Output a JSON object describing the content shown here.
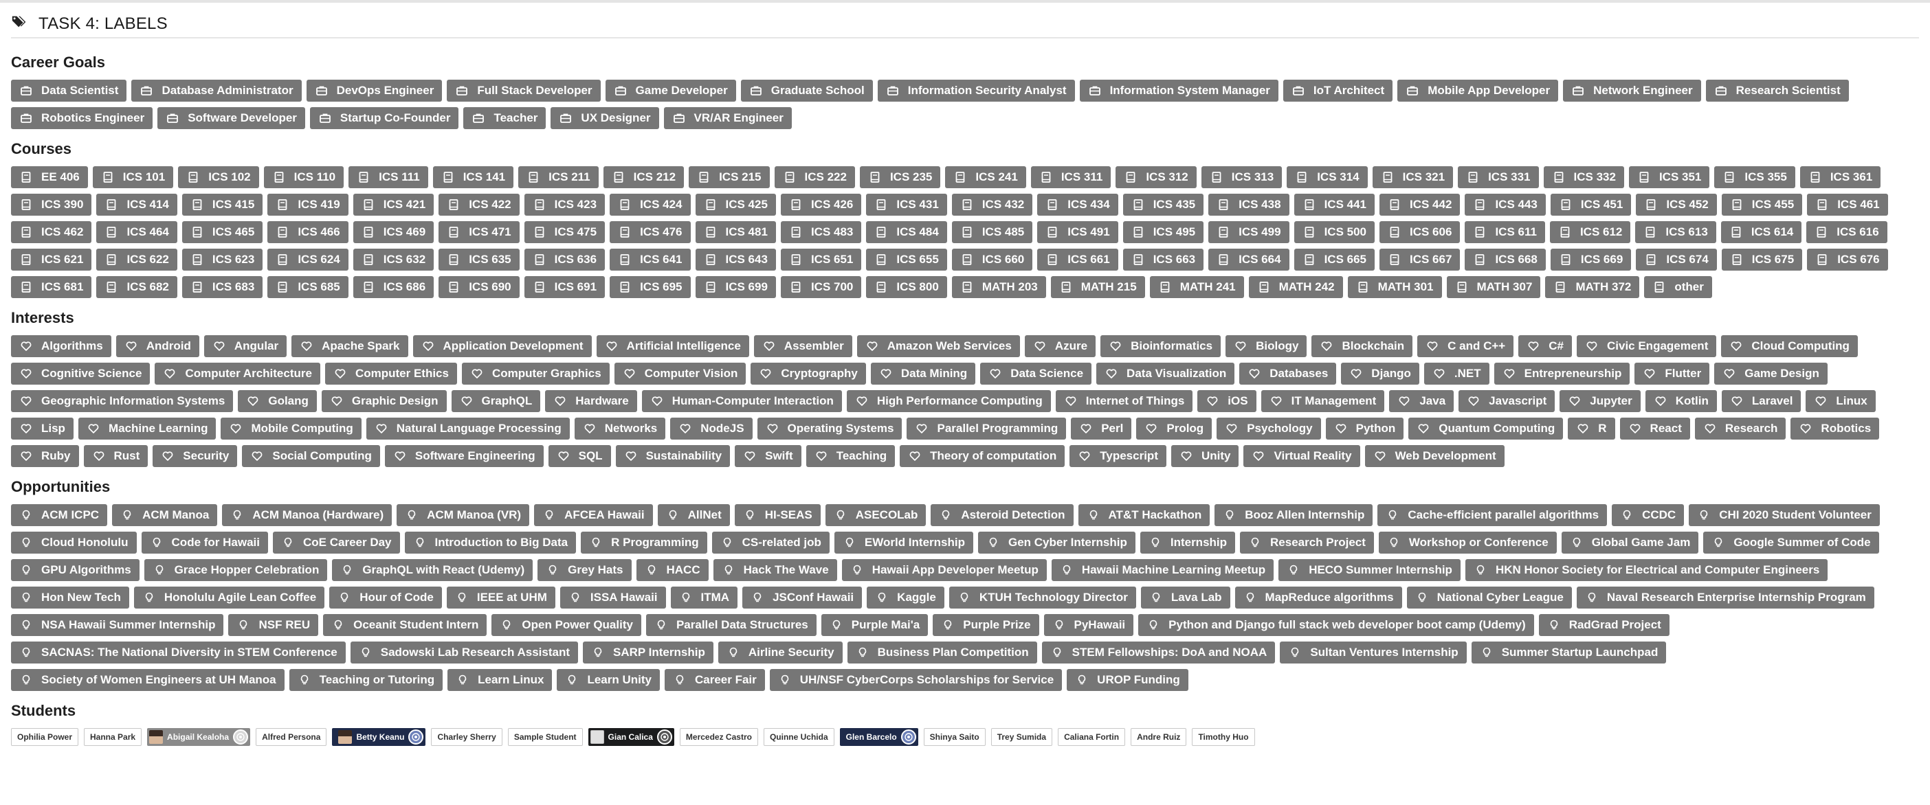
{
  "task_title": "TASK 4: LABELS",
  "sections": {
    "career_goals": {
      "title": "Career Goals",
      "icon": "briefcase-icon",
      "items": [
        "Data Scientist",
        "Database Administrator",
        "DevOps Engineer",
        "Full Stack Developer",
        "Game Developer",
        "Graduate School",
        "Information Security Analyst",
        "Information System Manager",
        "IoT Architect",
        "Mobile App Developer",
        "Network Engineer",
        "Research Scientist",
        "Robotics Engineer",
        "Software Developer",
        "Startup Co-Founder",
        "Teacher",
        "UX Designer",
        "VR/AR Engineer"
      ]
    },
    "courses": {
      "title": "Courses",
      "icon": "book-icon",
      "items": [
        "EE 406",
        "ICS 101",
        "ICS 102",
        "ICS 110",
        "ICS 111",
        "ICS 141",
        "ICS 211",
        "ICS 212",
        "ICS 215",
        "ICS 222",
        "ICS 235",
        "ICS 241",
        "ICS 311",
        "ICS 312",
        "ICS 313",
        "ICS 314",
        "ICS 321",
        "ICS 331",
        "ICS 332",
        "ICS 351",
        "ICS 355",
        "ICS 361",
        "ICS 390",
        "ICS 414",
        "ICS 415",
        "ICS 419",
        "ICS 421",
        "ICS 422",
        "ICS 423",
        "ICS 424",
        "ICS 425",
        "ICS 426",
        "ICS 431",
        "ICS 432",
        "ICS 434",
        "ICS 435",
        "ICS 438",
        "ICS 441",
        "ICS 442",
        "ICS 443",
        "ICS 451",
        "ICS 452",
        "ICS 455",
        "ICS 461",
        "ICS 462",
        "ICS 464",
        "ICS 465",
        "ICS 466",
        "ICS 469",
        "ICS 471",
        "ICS 475",
        "ICS 476",
        "ICS 481",
        "ICS 483",
        "ICS 484",
        "ICS 485",
        "ICS 491",
        "ICS 495",
        "ICS 499",
        "ICS 500",
        "ICS 606",
        "ICS 611",
        "ICS 612",
        "ICS 613",
        "ICS 614",
        "ICS 616",
        "ICS 621",
        "ICS 622",
        "ICS 623",
        "ICS 624",
        "ICS 632",
        "ICS 635",
        "ICS 636",
        "ICS 641",
        "ICS 643",
        "ICS 651",
        "ICS 655",
        "ICS 660",
        "ICS 661",
        "ICS 663",
        "ICS 664",
        "ICS 665",
        "ICS 667",
        "ICS 668",
        "ICS 669",
        "ICS 674",
        "ICS 675",
        "ICS 676",
        "ICS 681",
        "ICS 682",
        "ICS 683",
        "ICS 685",
        "ICS 686",
        "ICS 690",
        "ICS 691",
        "ICS 695",
        "ICS 699",
        "ICS 700",
        "ICS 800",
        "MATH 203",
        "MATH 215",
        "MATH 241",
        "MATH 242",
        "MATH 301",
        "MATH 307",
        "MATH 372",
        "other"
      ]
    },
    "interests": {
      "title": "Interests",
      "icon": "heart-outline-icon",
      "items": [
        "Algorithms",
        "Android",
        "Angular",
        "Apache Spark",
        "Application Development",
        "Artificial Intelligence",
        "Assembler",
        "Amazon Web Services",
        "Azure",
        "Bioinformatics",
        "Biology",
        "Blockchain",
        "C and C++",
        "C#",
        "Civic Engagement",
        "Cloud Computing",
        "Cognitive Science",
        "Computer Architecture",
        "Computer Ethics",
        "Computer Graphics",
        "Computer Vision",
        "Cryptography",
        "Data Mining",
        "Data Science",
        "Data Visualization",
        "Databases",
        "Django",
        ".NET",
        "Entrepreneurship",
        "Flutter",
        "Game Design",
        "Geographic Information Systems",
        "Golang",
        "Graphic Design",
        "GraphQL",
        "Hardware",
        "Human-Computer Interaction",
        "High Performance Computing",
        "Internet of Things",
        "iOS",
        "IT Management",
        "Java",
        "Javascript",
        "Jupyter",
        "Kotlin",
        "Laravel",
        "Linux",
        "Lisp",
        "Machine Learning",
        "Mobile Computing",
        "Natural Language Processing",
        "Networks",
        "NodeJS",
        "Operating Systems",
        "Parallel Programming",
        "Perl",
        "Prolog",
        "Psychology",
        "Python",
        "Quantum Computing",
        "R",
        "React",
        "Research",
        "Robotics",
        "Ruby",
        "Rust",
        "Security",
        "Social Computing",
        "Software Engineering",
        "SQL",
        "Sustainability",
        "Swift",
        "Teaching",
        "Theory of computation",
        "Typescript",
        "Unity",
        "Virtual Reality",
        "Web Development"
      ]
    },
    "opportunities": {
      "title": "Opportunities",
      "icon": "lightbulb-icon",
      "items": [
        "ACM ICPC",
        "ACM Manoa",
        "ACM Manoa (Hardware)",
        "ACM Manoa (VR)",
        "AFCEA Hawaii",
        "AllNet",
        "HI-SEAS",
        "ASECOLab",
        "Asteroid Detection",
        "AT&T Hackathon",
        "Booz Allen Internship",
        "Cache-efficient parallel algorithms",
        "CCDC",
        "CHI 2020 Student Volunteer",
        "Cloud Honolulu",
        "Code for Hawaii",
        "CoE Career Day",
        "Introduction to Big Data",
        "R Programming",
        "CS-related job",
        "EWorld Internship",
        "Gen Cyber Internship",
        "Internship",
        "Research Project",
        "Workshop or Conference",
        "Global Game Jam",
        "Google Summer of Code",
        "GPU Algorithms",
        "Grace Hopper Celebration",
        "GraphQL with React (Udemy)",
        "Grey Hats",
        "HACC",
        "Hack The Wave",
        "Hawaii App Developer Meetup",
        "Hawaii Machine Learning Meetup",
        "HECO Summer Internship",
        "HKN Honor Society for Electrical and Computer Engineers",
        "Hon New Tech",
        "Honolulu Agile Lean Coffee",
        "Hour of Code",
        "IEEE at UHM",
        "ISSA Hawaii",
        "ITMA",
        "JSConf Hawaii",
        "Kaggle",
        "KTUH Technology Director",
        "Lava Lab",
        "MapReduce algorithms",
        "National Cyber League",
        "Naval Research Enterprise Internship Program",
        "NSA Hawaii Summer Internship",
        "NSF REU",
        "Oceanit Student Intern",
        "Open Power Quality",
        "Parallel Data Structures",
        "Purple Mai'a",
        "Purple Prize",
        "PyHawaii",
        "Python and Django full stack web developer boot camp (Udemy)",
        "RadGrad Project",
        "SACNAS: The National Diversity in STEM Conference",
        "Sadowski Lab Research Assistant",
        "SARP Internship",
        "Airline Security",
        "Business Plan Competition",
        "STEM Fellowships: DoA and NOAA",
        "Sultan Ventures Internship",
        "Summer Startup Launchpad",
        "Society of Women Engineers at UH Manoa",
        "Teaching or Tutoring",
        "Learn Linux",
        "Learn Unity",
        "Career Fair",
        "UH/NSF CyberCorps Scholarships for Service",
        "UROP Funding"
      ]
    },
    "students": {
      "title": "Students",
      "items": [
        {
          "name": "Ophilia Power",
          "style": "plain"
        },
        {
          "name": "Hanna Park",
          "style": "plain"
        },
        {
          "name": "Abigail Kealoha",
          "style": "grey",
          "avatar": "photo",
          "badge": "light"
        },
        {
          "name": "Alfred Persona",
          "style": "plain"
        },
        {
          "name": "Betty Keanu",
          "style": "navy",
          "avatar": "photo",
          "badge": "blue"
        },
        {
          "name": "Charley Sherry",
          "style": "plain"
        },
        {
          "name": "Sample Student",
          "style": "plain"
        },
        {
          "name": "Gian Calica",
          "style": "dark",
          "avatar": "light",
          "badge": "dark"
        },
        {
          "name": "Mercedez Castro",
          "style": "plain"
        },
        {
          "name": "Quinne Uchida",
          "style": "plain"
        },
        {
          "name": "Glen Barcelo",
          "style": "navy",
          "badge": "blue"
        },
        {
          "name": "Shinya Saito",
          "style": "plain"
        },
        {
          "name": "Trey Sumida",
          "style": "plain"
        },
        {
          "name": "Caliana Fortin",
          "style": "plain"
        },
        {
          "name": "Andre Ruiz",
          "style": "plain"
        },
        {
          "name": "Timothy Huo",
          "style": "plain"
        }
      ]
    }
  },
  "colors": {
    "label_bg": "#767676",
    "label_text": "#ffffff",
    "navy": "#1e2a4a",
    "dark": "#1b1c1d"
  }
}
